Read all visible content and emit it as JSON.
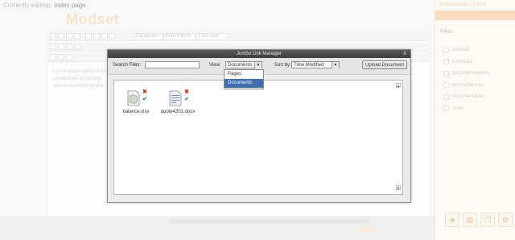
{
  "top": {
    "label": "Currently editing:",
    "page": "index page"
  },
  "brand": "Modset",
  "toolbar": {
    "format_select": "Paragraph",
    "font_select": "Font Family",
    "size_select": "Font size"
  },
  "editor_lines": [
    "Lorem ipsum dolor sit amet",
    "consectetur adipiscing",
    "sed do eiusmod tempor"
  ],
  "right_panel": {
    "link": "All documents | | docs",
    "title": "Files",
    "items": [
      "sitemap",
      "contactus",
      "documentsgallery",
      "termsofservice",
      "documentation",
      "order"
    ]
  },
  "dialog": {
    "title": "Jumbo Link Manager",
    "close": "x",
    "search_label": "Search Files:",
    "search_value": "",
    "view_label": "View:",
    "view_selected": "Documents",
    "view_options": [
      "Pages",
      "Documents"
    ],
    "sort_label": "Sort by:",
    "sort_selected": "Time Modified",
    "upload_button": "Upload Document",
    "files": [
      {
        "name": "balance.xlsx",
        "icon": "spreadsheet-file-icon"
      },
      {
        "name": "quote4301.docx",
        "icon": "word-document-file-icon"
      }
    ]
  },
  "colors": {
    "title_bar": "#3c3c3c",
    "selected_option": "#3d6fb0",
    "delete": "#c0392b",
    "confirm": "#2e9b3a"
  }
}
